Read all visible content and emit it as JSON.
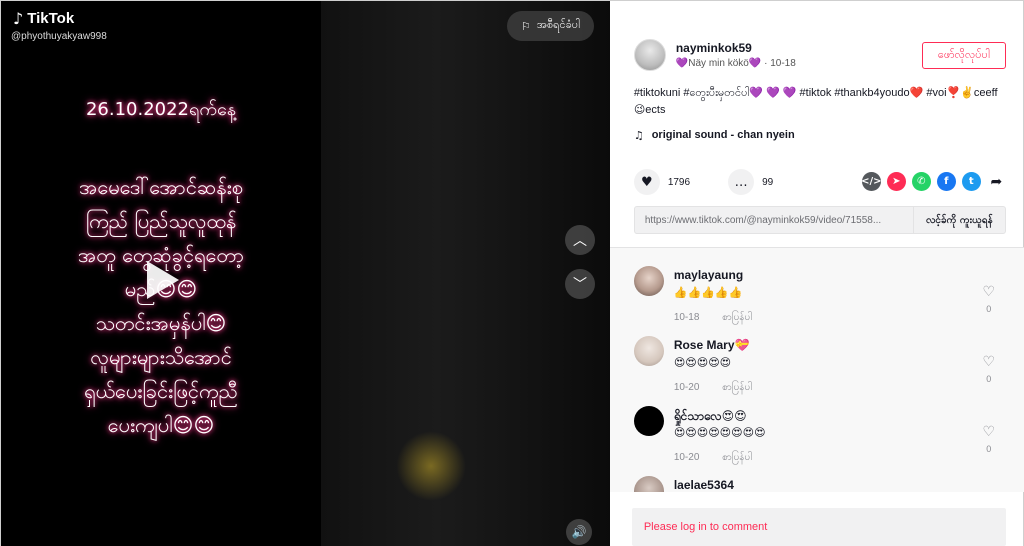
{
  "video": {
    "brand": "TikTok",
    "username": "@phyothuyakyaw998",
    "report_label": "အစီရင်ခံပါ",
    "overlay_date": "26.10.2022ရက်နေ့",
    "overlay_lines": [
      "အမေဒေါ်အောင်ဆန်းစု",
      "ကြည် ပြည်သူလူထုန်",
      "အတူ တွေဆုံခွင့်ရတော့",
      "မည်😊😊",
      "သတင်းအမှန်ပါ😊",
      "လူများများသိအောင်",
      "ရှယ်ပေးခြင်းဖြင့်ကူညီ",
      "ပေးကျပါ😊😊"
    ],
    "icons": {
      "logo": "tiktok-note-icon",
      "report": "flag-icon",
      "play": "play-icon",
      "up": "chevron-up-icon",
      "down": "chevron-down-icon",
      "sound": "speaker-icon"
    }
  },
  "author": {
    "username": "nayminkok59",
    "nickname": "💜Näy min kökö💜",
    "date": "10-18",
    "separator": "·",
    "follow_label": "ဖော်လိုလုပ်ပါ"
  },
  "caption": "#tiktokuni #တွေးပီးမှတင်ပါ💜 💜 💜 #tiktok #thankb4youdo❤️ #voi❣️✌️ceeff😉ects",
  "music": "original sound - chan nyein",
  "stats": {
    "likes": "1796",
    "comments": "99"
  },
  "share": {
    "link": "https://www.tiktok.com/@nayminkok59/video/71558...",
    "copy_label": "လင့်ခ်ကို ကူးယူရန်",
    "icons": [
      "embed-icon",
      "send-icon",
      "whatsapp-icon",
      "facebook-icon",
      "twitter-icon",
      "share-arrow-icon"
    ]
  },
  "comments": [
    {
      "name": "maylayaung",
      "text": "👍👍👍👍👍",
      "date": "10-18",
      "reply": "စာပြန်ပါ",
      "likes": "0"
    },
    {
      "name": "Rose Mary💝",
      "text": "😍😍😍😍😍",
      "date": "10-20",
      "reply": "စာပြန်ပါ",
      "likes": "0"
    },
    {
      "name": "ရှိုင်သာလေ😍😍",
      "text": "😍😍😍😍😍😍😍😍",
      "date": "10-20",
      "reply": "စာပြန်ပါ",
      "likes": "0"
    },
    {
      "name": "laelae5364",
      "text": "",
      "date": "",
      "reply": "",
      "likes": ""
    }
  ],
  "login_prompt": "Please log in to comment",
  "colors": {
    "brand_red": "#fe2c55",
    "text_dark": "#161823",
    "muted": "#8a8b91"
  }
}
